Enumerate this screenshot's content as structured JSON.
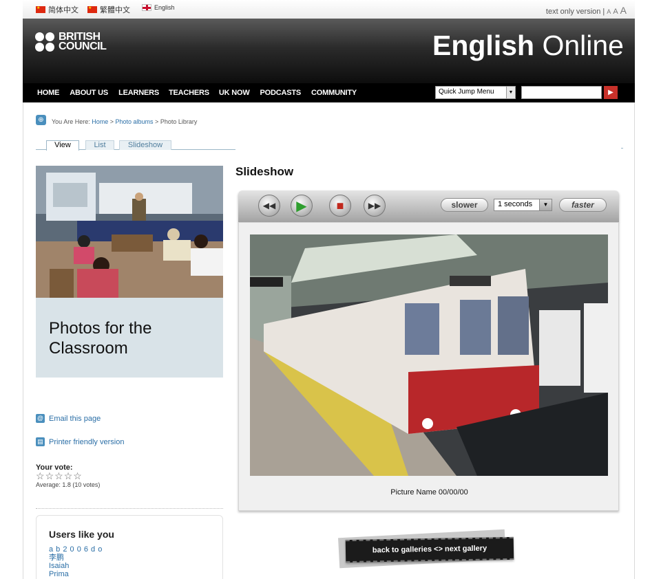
{
  "languages": [
    {
      "label": "简体中文",
      "icon": "china-flag-icon"
    },
    {
      "label": "繁體中文",
      "icon": "china-flag-icon"
    },
    {
      "label": "English",
      "icon": "uk-flag-icon"
    }
  ],
  "accessibility": {
    "text_only": "text only version |",
    "size_small": "A",
    "size_medium": "A",
    "size_large": "A"
  },
  "header": {
    "logo_line1": "BRITISH",
    "logo_line2": "COUNCIL",
    "brand_bold": "English",
    "brand_light": " Online"
  },
  "nav": {
    "items": [
      "HOME",
      "ABOUT US",
      "LEARNERS",
      "TEACHERS",
      "UK NOW",
      "PODCASTS",
      "COMMUNITY"
    ],
    "quick_jump": "Quick Jump Menu"
  },
  "breadcrumb": {
    "prefix": "You Are Here: ",
    "home": "Home",
    "sep": " > ",
    "albums": "Photo albums",
    "current": "Photo Library"
  },
  "tabs": [
    "View",
    "List",
    "Slideshow"
  ],
  "feature": {
    "title": "Photos for the Classroom"
  },
  "sidebar": {
    "email": "Email this page",
    "print": "Printer friendly version"
  },
  "vote": {
    "label": "Your vote:",
    "average": "Average: 1.8 (10 votes)",
    "stars": 5
  },
  "users": {
    "title": "Users like you",
    "names": [
      "a b 2 0 0 6 d o",
      "李鹏",
      "Isaiah",
      "Prima"
    ]
  },
  "slideshow": {
    "heading": "Slideshow",
    "slower": "slower",
    "faster": "faster",
    "speed": "1 seconds",
    "caption": "Picture Name 00/00/00",
    "nav_link": "back to galleries <> next gallery"
  },
  "colors": {
    "link": "#2a6ea6",
    "header_bg": "#000000",
    "panel_bg": "#d9e3e8"
  }
}
